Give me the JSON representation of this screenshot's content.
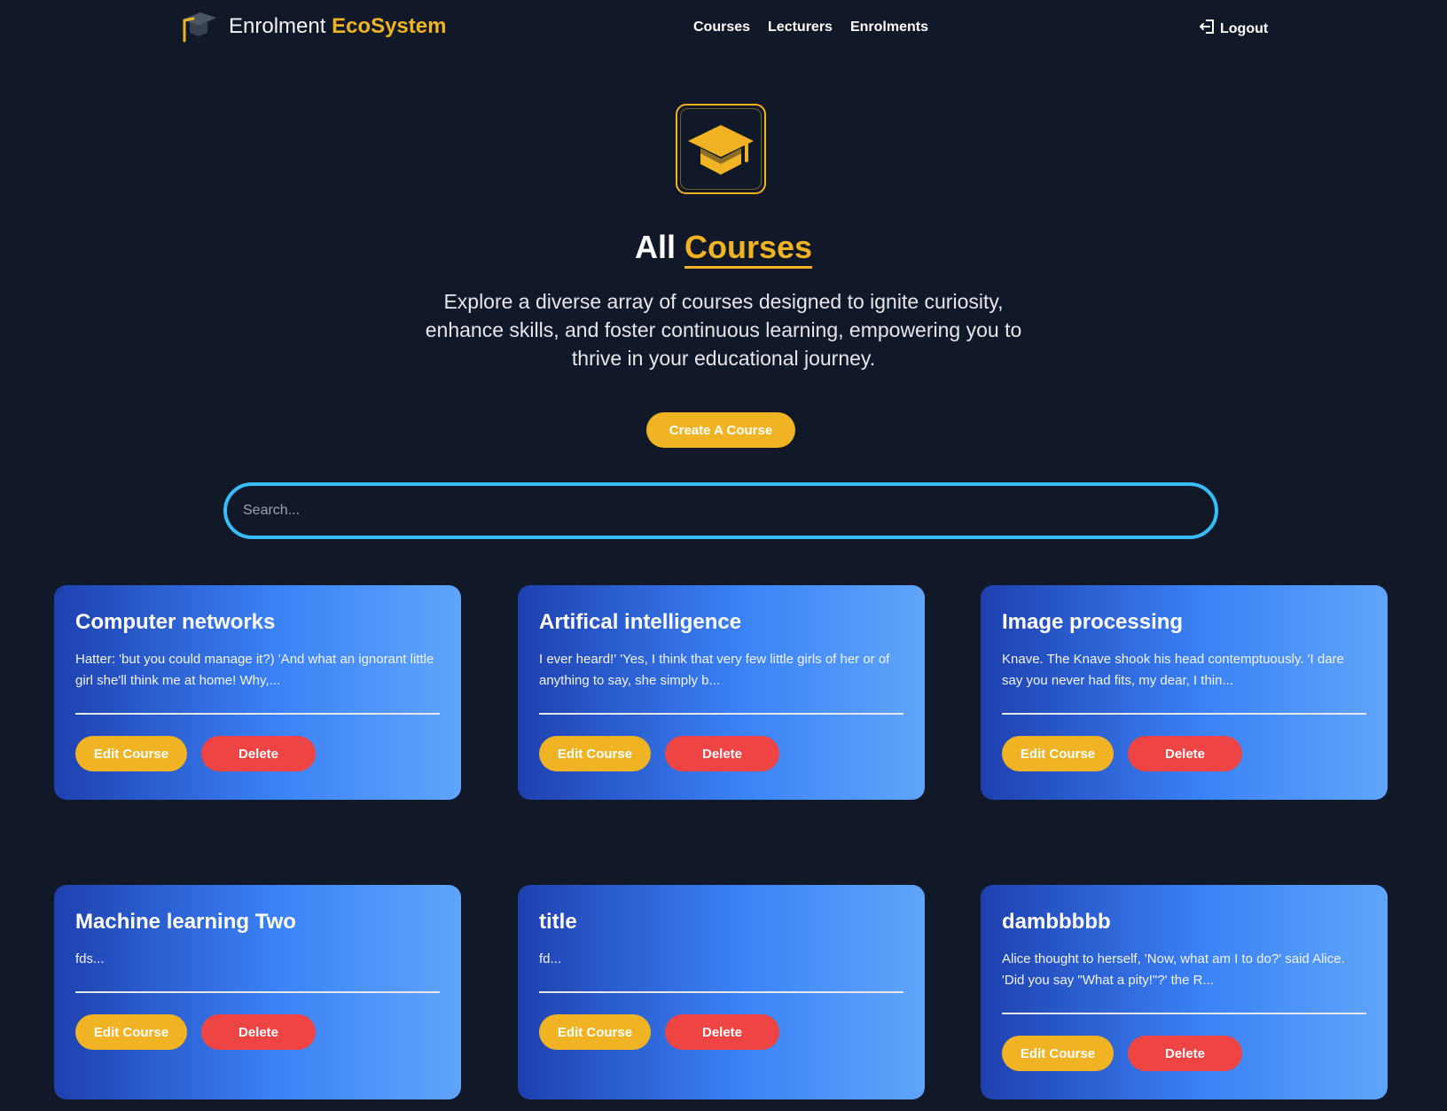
{
  "nav": {
    "brand_prefix": "Enrolment",
    "brand_accent": "EcoSystem",
    "links": [
      "Courses",
      "Lecturers",
      "Enrolments"
    ],
    "logout": "Logout"
  },
  "hero": {
    "title_prefix": "All",
    "title_accent": "Courses",
    "subtitle": "Explore a diverse array of courses designed to ignite curiosity, enhance skills, and foster continuous learning, empowering you to thrive in your educational journey.",
    "create_button": "Create A Course"
  },
  "search": {
    "placeholder": "Search...",
    "value": ""
  },
  "courses": [
    {
      "title": "Computer networks",
      "description": "Hatter: 'but you could manage it?) 'And what an ignorant little girl she'll think me at home! Why,..."
    },
    {
      "title": "Artifical intelligence",
      "description": "I ever heard!' 'Yes, I think that very few little girls of her or of anything to say, she simply b..."
    },
    {
      "title": "Image processing",
      "description": "Knave. The Knave shook his head contemptuously. 'I dare say you never had fits, my dear, I thin..."
    },
    {
      "title": "Machine learning Two",
      "description": "fds..."
    },
    {
      "title": "title",
      "description": "fd..."
    },
    {
      "title": "dambbbbb",
      "description": "Alice thought to herself, 'Now, what am I to do?' said Alice. 'Did you say \"What a pity!\"?' the R..."
    }
  ],
  "card_actions": {
    "edit": "Edit Course",
    "delete": "Delete"
  },
  "colors": {
    "background": "#111827",
    "accent": "#f0b323",
    "danger": "#ef4444",
    "search_border": "#38bdf8",
    "card_gradient_start": "#1e40af",
    "card_gradient_end": "#60a5fa"
  },
  "icons": {
    "brand": "graduation-cap-icon",
    "logout": "logout-icon",
    "hero": "graduation-cap-icon"
  }
}
